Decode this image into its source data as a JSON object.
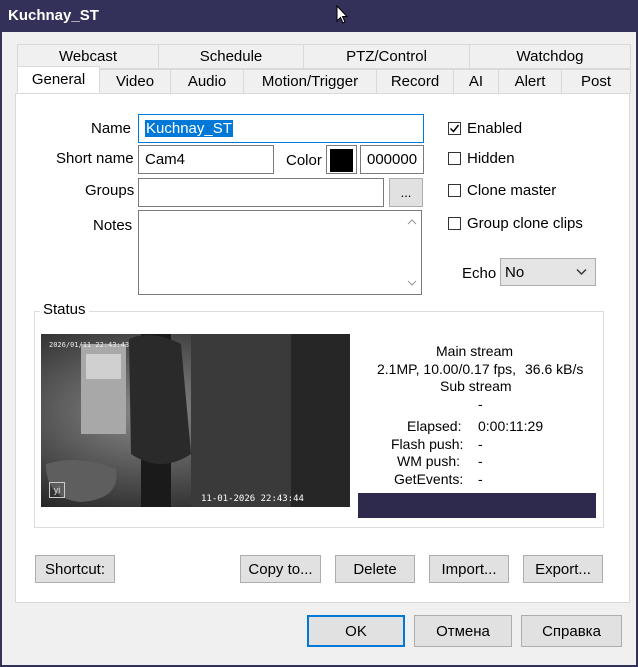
{
  "window": {
    "title": "Kuchnay_ST"
  },
  "tabs_row1": [
    {
      "label": "Webcast"
    },
    {
      "label": "Schedule"
    },
    {
      "label": "PTZ/Control"
    },
    {
      "label": "Watchdog"
    }
  ],
  "tabs_row2": [
    {
      "label": "General",
      "active": true
    },
    {
      "label": "Video"
    },
    {
      "label": "Audio"
    },
    {
      "label": "Motion/Trigger"
    },
    {
      "label": "Record"
    },
    {
      "label": "AI"
    },
    {
      "label": "Alert"
    },
    {
      "label": "Post"
    }
  ],
  "general": {
    "name_label": "Name",
    "name_value": "Kuchnay_ST",
    "short_name_label": "Short name",
    "short_name_value": "Cam4",
    "color_label": "Color",
    "color_value": "000000",
    "color_swatch": "#000000",
    "groups_label": "Groups",
    "groups_value": "",
    "groups_button": "...",
    "notes_label": "Notes",
    "notes_value": "",
    "enabled_label": "Enabled",
    "enabled_checked": true,
    "hidden_label": "Hidden",
    "hidden_checked": false,
    "clone_master_label": "Clone master",
    "clone_master_checked": false,
    "group_clone_clips_label": "Group clone clips",
    "group_clone_clips_checked": false,
    "echo_label": "Echo",
    "echo_value": "No"
  },
  "status": {
    "title": "Status",
    "preview_timestamp_top": "2026/01/11 22:43:43",
    "preview_timestamp_bottom": "11-01-2026 22:43:44",
    "preview_logo": "yi",
    "main_stream_label": "Main stream",
    "main_stream_info": "2.1MP, 10.00/0.17 fps,",
    "main_stream_rate": "36.6 kB/s",
    "sub_stream_label": "Sub stream",
    "sub_stream_info": "-",
    "elapsed_label": "Elapsed:",
    "elapsed_value": "0:00:11:29",
    "flash_push_label": "Flash push:",
    "flash_push_value": "-",
    "wm_push_label": "WM push:",
    "wm_push_value": "-",
    "getevents_label": "GetEvents:",
    "getevents_value": "-"
  },
  "actions": {
    "shortcut": "Shortcut:",
    "copy_to": "Copy to...",
    "delete": "Delete",
    "import": "Import...",
    "export": "Export..."
  },
  "dialog_buttons": {
    "ok": "OK",
    "cancel": "Отмена",
    "help": "Справка"
  },
  "colors": {
    "titlebar": "#33305a",
    "selection": "#0078d7",
    "progress": "#2d2a4e"
  }
}
